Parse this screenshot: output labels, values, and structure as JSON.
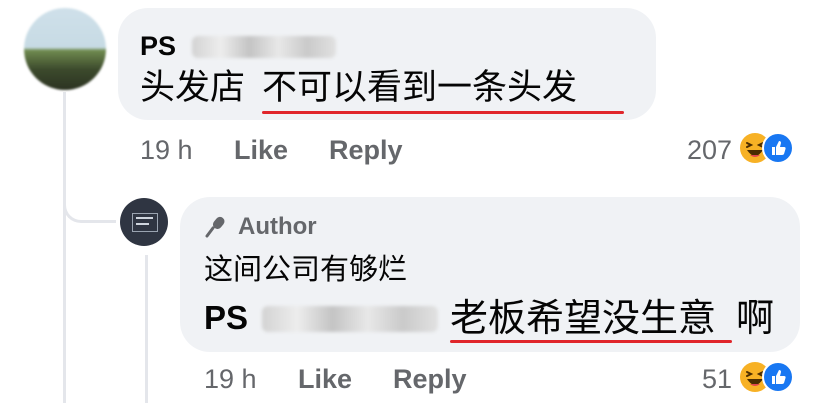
{
  "comment": {
    "author_visible": "PS",
    "text_plain": "头发店",
    "text_underlined": "不可以看到一条头发",
    "time": "19 h",
    "like_label": "Like",
    "reply_label": "Reply",
    "reaction_count": "207",
    "reaction_icons": [
      "haha-emoji-icon",
      "like-thumb-icon"
    ]
  },
  "reply": {
    "author_badge_label": "Author",
    "author_badge_icon": "microphone-icon",
    "line1": "这间公司有够烂",
    "mention_visible": "PS",
    "line2_underlined": "老板希望没生意",
    "line2_tail": "啊",
    "time": "19 h",
    "like_label": "Like",
    "reply_label": "Reply",
    "reaction_count": "51",
    "reaction_icons": [
      "haha-emoji-icon",
      "like-thumb-icon"
    ]
  },
  "colors": {
    "bubble_bg": "#f0f2f5",
    "meta_text": "#65676b",
    "like_blue": "#1877f2",
    "haha_yellow": "#f7b125",
    "underline_red": "#e0262b",
    "thread_line": "#e4e6eb"
  }
}
